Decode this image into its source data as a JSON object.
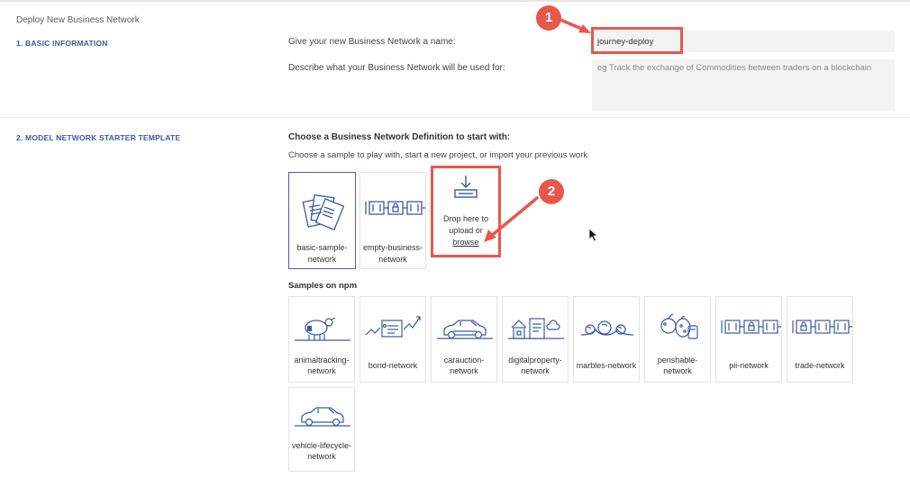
{
  "page": {
    "title": "Deploy New Business Network"
  },
  "basic_info": {
    "section_label": "1. BASIC INFORMATION",
    "name_label": "Give your new Business Network a name:",
    "name_value": "journey-deploy",
    "desc_label": "Describe what your Business Network will be used for:",
    "desc_placeholder": "eg Track the exchange of Commodities between traders on a blockchain"
  },
  "template": {
    "section_label": "2. MODEL NETWORK STARTER TEMPLATE",
    "heading": "Choose a Business Network Definition to start with:",
    "subtext": "Choose a sample to play with, start a new project, or import your previous work",
    "cards": [
      {
        "label": "basic-sample-network",
        "icon": "documents-icon",
        "selected": true
      },
      {
        "label": "empty-business-network",
        "icon": "chain-blocks-icon",
        "selected": false
      }
    ],
    "upload": {
      "text": "Drop here to upload or",
      "link": "browse",
      "icon": "download-tray-icon"
    },
    "npm_heading": "Samples on npm",
    "npm_samples": [
      {
        "label": "animaltracking-network",
        "icon": "sheep-icon"
      },
      {
        "label": "bond-network",
        "icon": "bond-chart-icon"
      },
      {
        "label": "carauction-network",
        "icon": "car-icon"
      },
      {
        "label": "digitalproperty-network",
        "icon": "property-icon"
      },
      {
        "label": "marbles-network",
        "icon": "marbles-icon"
      },
      {
        "label": "perishable-network",
        "icon": "produce-icon"
      },
      {
        "label": "pii-network",
        "icon": "chain-blocks-icon"
      },
      {
        "label": "trade-network",
        "icon": "chain-blocks-icon"
      },
      {
        "label": "vehicle-lifecycle-network",
        "icon": "car-icon"
      }
    ]
  },
  "annotations": {
    "marker1": "1",
    "marker2": "2"
  },
  "colors": {
    "accent": "#3b5aa6",
    "annotation": "#e8574b",
    "input_bg": "#f3f3f3"
  }
}
